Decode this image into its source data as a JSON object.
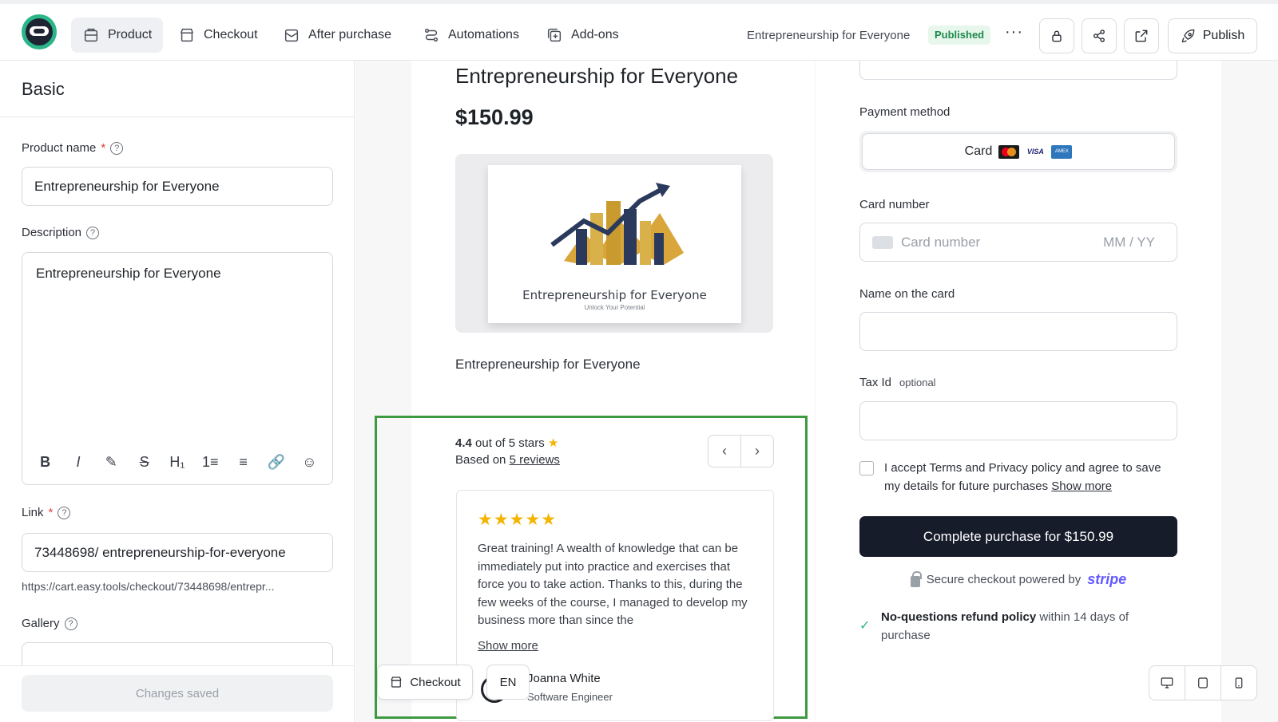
{
  "nav": {
    "tabs": [
      {
        "label": "Product",
        "icon": "wallet-icon"
      },
      {
        "label": "Checkout",
        "icon": "store-icon"
      },
      {
        "label": "After purchase",
        "icon": "mail-icon"
      },
      {
        "label": "Automations",
        "icon": "route-icon"
      },
      {
        "label": "Add-ons",
        "icon": "plus-square-icon"
      }
    ],
    "product_title": "Entrepreneurship for Everyone",
    "status_badge": "Published",
    "more": "···",
    "publish_label": "Publish"
  },
  "left": {
    "section_title": "Basic",
    "product_name_label": "Product name",
    "product_name_value": "Entrepreneurship for Everyone",
    "description_label": "Description",
    "description_value": "Entrepreneurship for Everyone",
    "toolbar": [
      "B",
      "I",
      "✎",
      "S",
      "H₁",
      "1≡",
      "≡",
      "🔗",
      "☺"
    ],
    "link_label": "Link",
    "link_value": "73448698/ entrepreneurship-for-everyone",
    "link_url": "https://cart.easy.tools/checkout/73448698/entrepr...",
    "gallery_label": "Gallery",
    "changes_saved": "Changes saved",
    "required_mark": "*",
    "help_mark": "?"
  },
  "product": {
    "title": "Entrepreneurship for Everyone",
    "price": "$150.99",
    "image_title": "Entrepreneurship for Everyone",
    "image_subtitle": "Unlock Your Potential",
    "description": "Entrepreneurship for Everyone"
  },
  "reviews": {
    "rating_value": "4.4",
    "rating_text": " out of 5 stars ",
    "star": "★",
    "based_on": "Based on ",
    "reviews_link": "5 reviews",
    "prev": "‹",
    "next": "›",
    "stars": "★★★★★",
    "text": "Great training! A wealth of knowledge that can be immediately put into practice and exercises that force you to take action. Thanks to this, during the few weeks of the course, I managed to develop my business more than since the",
    "show_more": "Show more",
    "author_name": "Joanna White",
    "author_role": "Software Engineer"
  },
  "floating": {
    "checkout_label": "Checkout",
    "lang": "EN"
  },
  "checkout": {
    "payment_method_label": "Payment method",
    "card_label": "Card",
    "visa": "VISA",
    "amex": "AMEX",
    "card_number_label": "Card number",
    "card_number_placeholder": "Card number",
    "expiry_placeholder": "MM / YY",
    "name_label": "Name on the card",
    "tax_label": "Tax Id",
    "tax_optional": "optional",
    "terms_text": "I accept Terms and Privacy policy and agree to save my details for future purchases ",
    "terms_show_more": "Show more",
    "buy_button": "Complete purchase for $150.99",
    "secure_text": "Secure checkout powered by",
    "stripe": "stripe",
    "refund_bold": "No-questions refund policy",
    "refund_rest": " within 14 days of purchase",
    "check": "✓"
  }
}
